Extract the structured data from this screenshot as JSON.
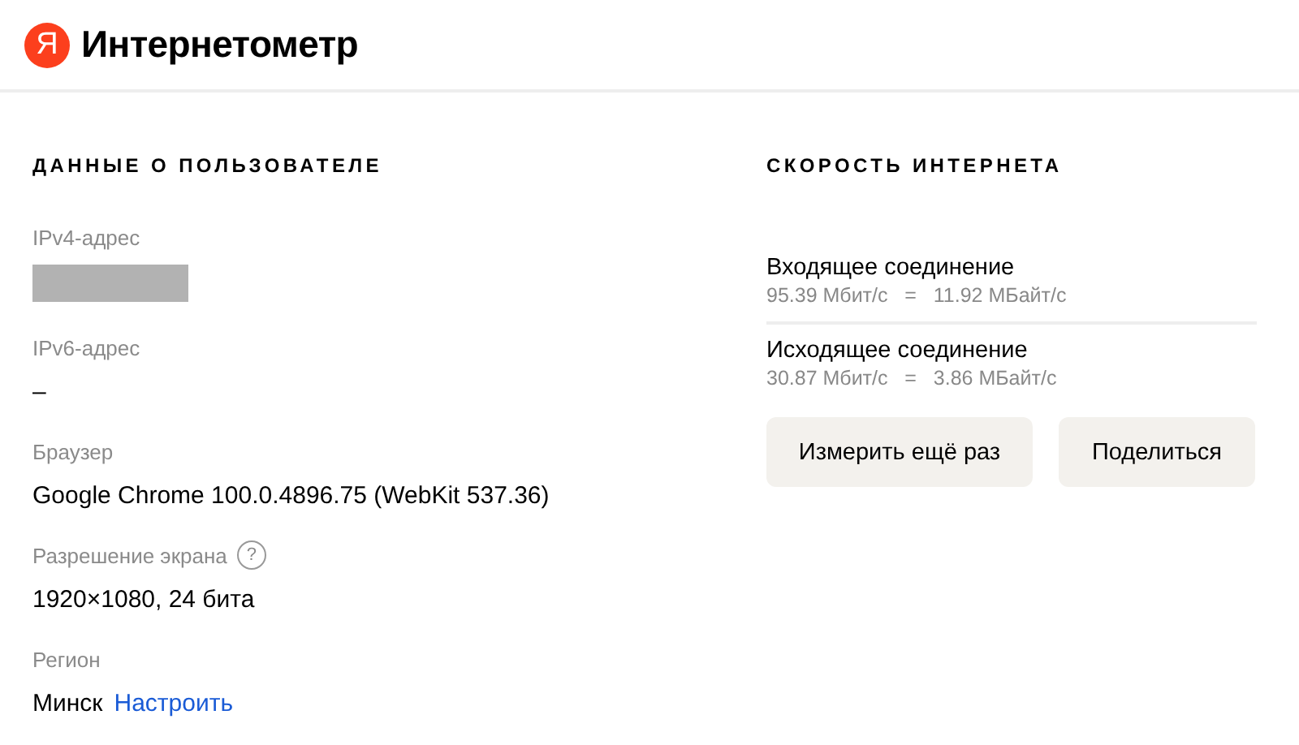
{
  "header": {
    "logo_letter": "Я",
    "title": "Интернетометр"
  },
  "user_data": {
    "title": "ДАННЫЕ О ПОЛЬЗОВАТЕЛЕ",
    "fields": [
      {
        "kind": "redacted",
        "label": "IPv4-адрес"
      },
      {
        "kind": "text",
        "label": "IPv6-адрес",
        "value": "–"
      },
      {
        "kind": "text",
        "label": "Браузер",
        "value": "Google Chrome 100.0.4896.75 (WebKit 537.36)"
      },
      {
        "kind": "help",
        "label": "Разрешение экрана",
        "help": "?",
        "value": "1920×1080, 24 бита"
      },
      {
        "kind": "link",
        "label": "Регион",
        "value": "Минск",
        "link": "Настроить"
      }
    ]
  },
  "speed": {
    "title": "СКОРОСТЬ ИНТЕРНЕТА",
    "connections": [
      {
        "name": "Входящее соединение",
        "mbit": "95.39 Мбит/с",
        "eq": "=",
        "mbyte": "11.92 МБайт/с"
      },
      {
        "name": "Исходящее соединение",
        "mbit": "30.87 Мбит/с",
        "eq": "=",
        "mbyte": "3.86 МБайт/с"
      }
    ],
    "buttons": [
      "Измерить ещё раз",
      "Поделиться"
    ]
  }
}
